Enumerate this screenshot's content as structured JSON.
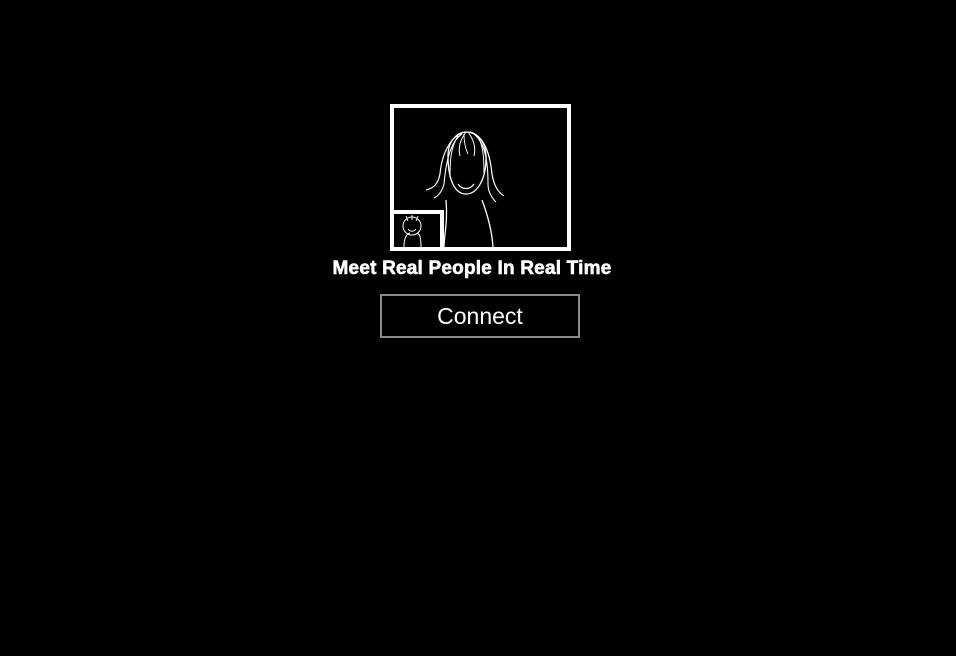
{
  "hero": {
    "logo_icon": "video-chat-illustration-icon",
    "tagline": "Meet Real People In Real Time"
  },
  "actions": {
    "connect_label": "Connect"
  },
  "colors": {
    "background": "#000000",
    "foreground": "#ffffff",
    "button_border": "#8a8a8a"
  }
}
